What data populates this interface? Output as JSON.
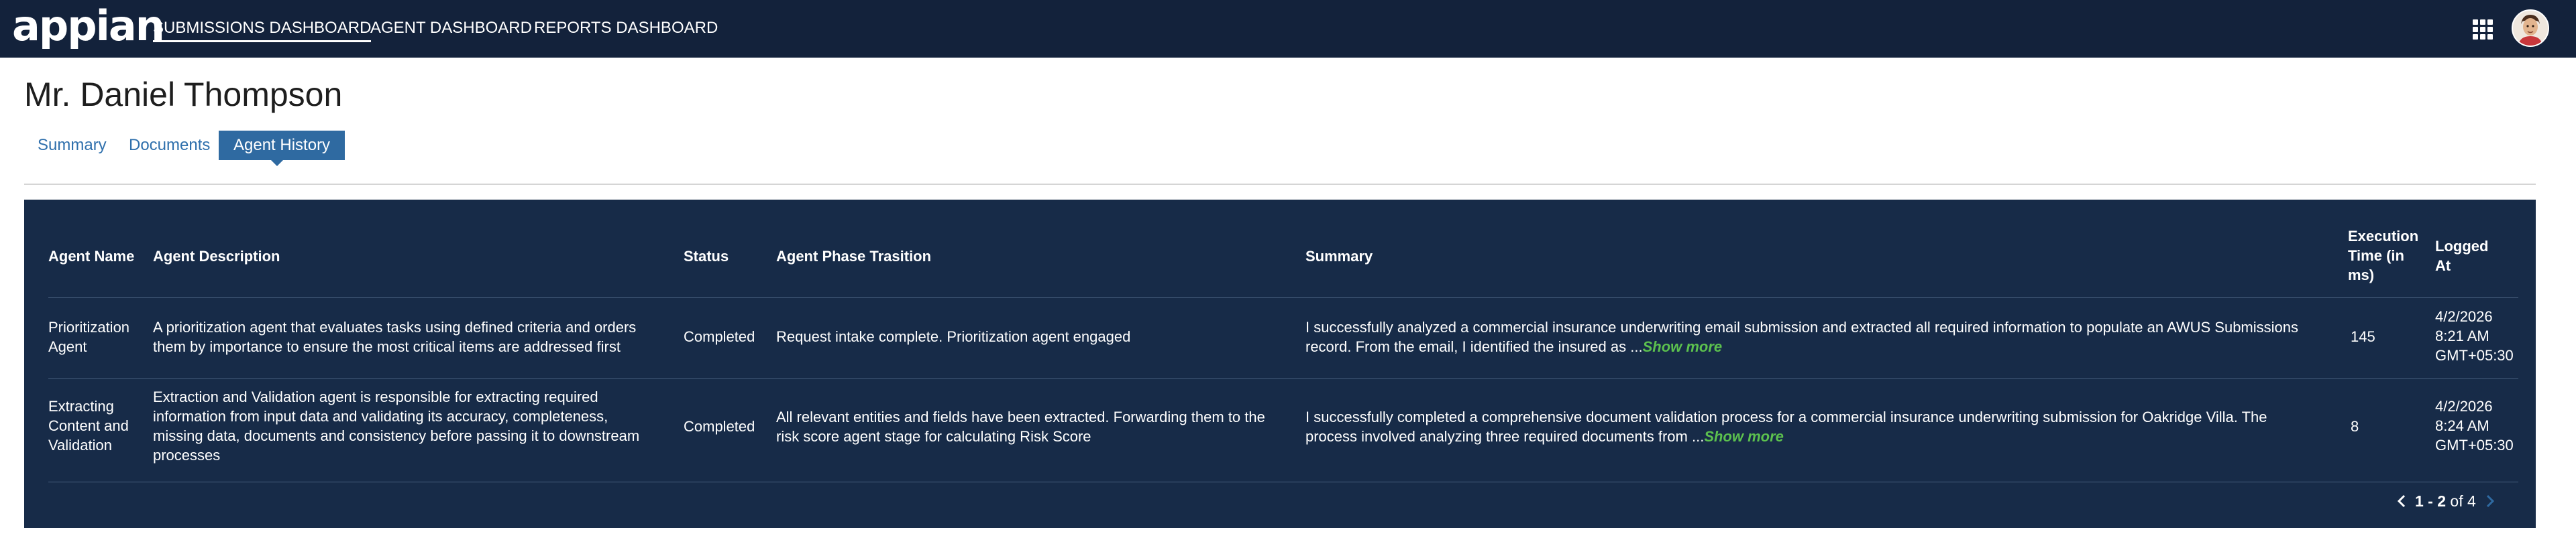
{
  "topbar": {
    "logo_text": "appian",
    "nav": [
      {
        "label": "SUBMISSIONS DASHBOARD",
        "active": true
      },
      {
        "label": "AGENT DASHBOARD",
        "active": false
      },
      {
        "label": "REPORTS DASHBOARD",
        "active": false
      }
    ],
    "apps_icon": "grid-icon",
    "avatar_icon": "user-avatar"
  },
  "page": {
    "title": "Mr. Daniel Thompson",
    "tabs": [
      {
        "label": "Summary",
        "active": false
      },
      {
        "label": "Documents",
        "active": false
      },
      {
        "label": "Agent History",
        "active": true
      }
    ]
  },
  "table": {
    "headers": {
      "agent_name": "Agent Name",
      "agent_description": "Agent Description",
      "status": "Status",
      "phase": "Agent Phase Trasition",
      "summary": "Summary",
      "execution_time_1": "Execution",
      "execution_time_2": "Time (in",
      "execution_time_3": "ms)",
      "logged_at_1": "Logged",
      "logged_at_2": "At"
    },
    "rows": [
      {
        "agent_name_1": "Prioritization",
        "agent_name_2": "Agent",
        "description_1": "A prioritization agent that evaluates tasks using defined criteria and orders",
        "description_2": "them by importance to ensure the most critical items are addressed first",
        "status": "Completed",
        "phase_1": "Request intake complete. Prioritization agent engaged",
        "summary_1": "I successfully analyzed a commercial insurance underwriting email submission and extracted all required information to populate an AWUS Submissions",
        "summary_2": "record. From the email, I identified the insured as ",
        "summary_ellipsis": " ...",
        "show_more": "Show more",
        "execution_time": "145",
        "logged_1": "4/2/2026",
        "logged_2": "8:21 AM",
        "logged_3": "GMT+05:30"
      },
      {
        "agent_name_1": "Extracting",
        "agent_name_2": "Content and",
        "agent_name_3": "Validation",
        "description_1": "Extraction and Validation agent is responsible for extracting required",
        "description_2": "information from input data and validating its accuracy, completeness,",
        "description_3": "missing data, documents and consistency before passing it to downstream",
        "description_4": "processes",
        "status": "Completed",
        "phase_1": "All relevant entities and fields have been extracted. Forwarding them to the",
        "phase_2": "risk score agent stage for calculating Risk Score",
        "summary_1": "I successfully completed a comprehensive document validation process for a commercial insurance underwriting submission for Oakridge Villa. The",
        "summary_2": "process involved analyzing three required documents from ",
        "summary_ellipsis": "...",
        "show_more": "Show more",
        "execution_time": "8",
        "logged_1": "4/2/2026",
        "logged_2": "8:24 AM",
        "logged_3": "GMT+05:30"
      }
    ]
  },
  "pagination": {
    "range": "1 - 2",
    "of_text": "of",
    "total": "4",
    "prev_icon": "chevron-left-icon",
    "next_icon": "chevron-right-icon"
  },
  "colors": {
    "topbar_bg": "#13223b",
    "panel_bg": "#172b48",
    "accent": "#2f6aa1",
    "show_more": "#5cc14e"
  }
}
